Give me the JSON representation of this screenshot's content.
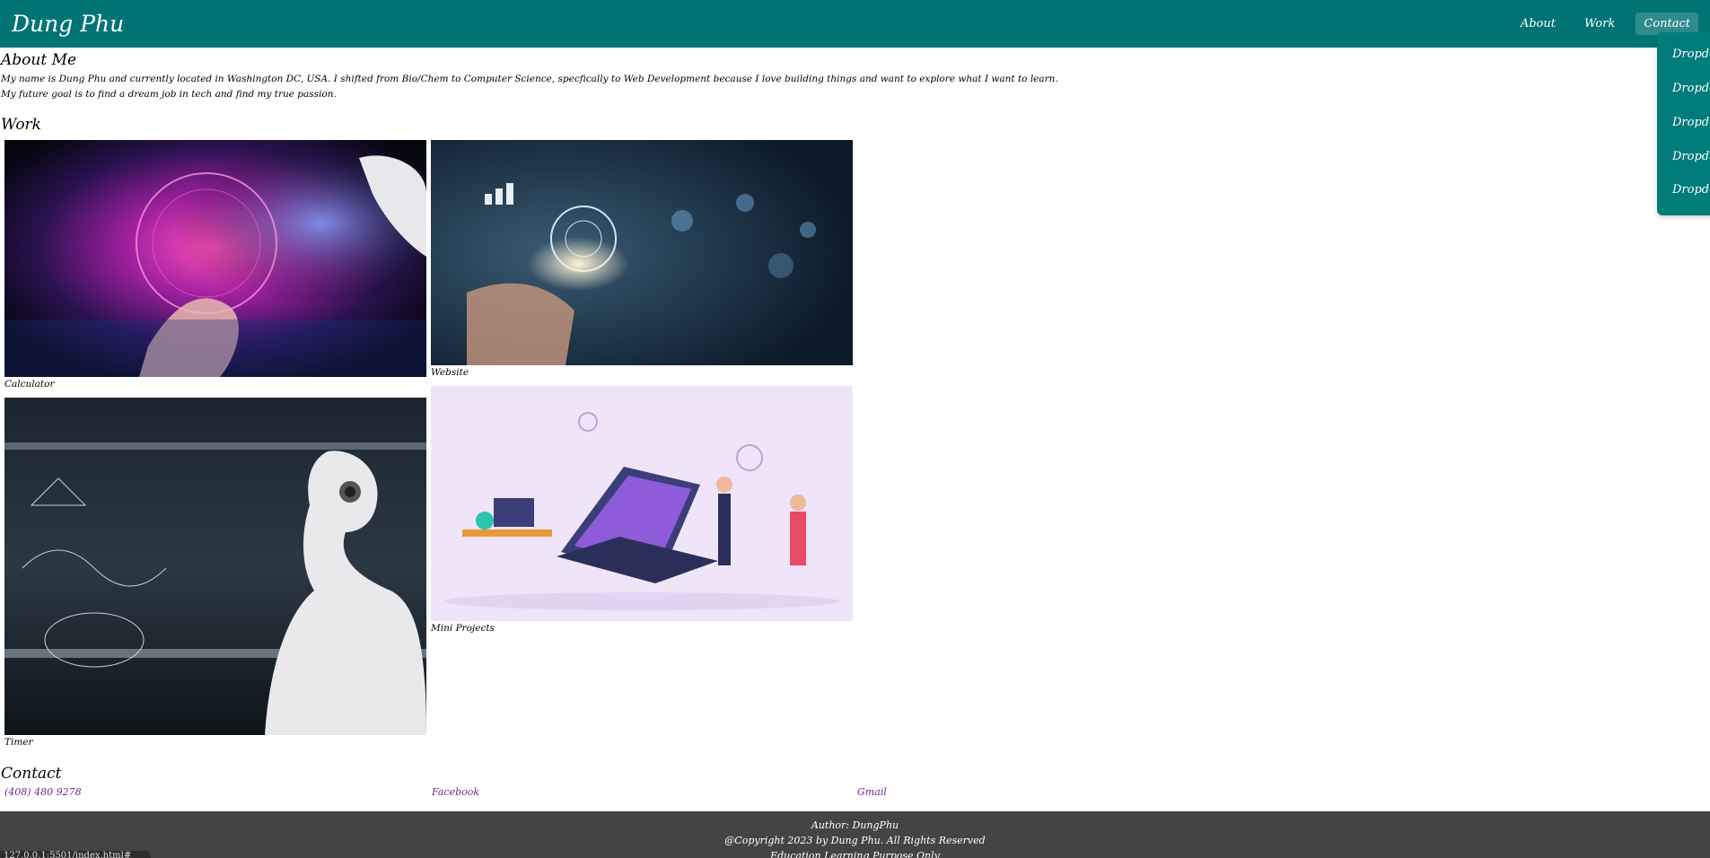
{
  "navbar": {
    "brand": "Dung Phu",
    "links": [
      "About",
      "Work",
      "Contact"
    ],
    "active": "Contact"
  },
  "dropdown": {
    "items": [
      "Dropdown",
      "Dropdown",
      "Dropdown",
      "Dropdown",
      "Dropdown"
    ]
  },
  "about": {
    "heading": "About Me",
    "line1": "My name is Dung Phu and currently located in Washington DC, USA. I shifted from Bio/Chem to Computer Science, specfically to Web Development because I love building things and want to explore what I want to learn.",
    "line2": "My future goal is to find a dream job in tech and find my true passion."
  },
  "work": {
    "heading": "Work",
    "projects": [
      {
        "caption": "Calculator",
        "image": "ai-hand-globe-image"
      },
      {
        "caption": "Website",
        "image": "globe-network-hand-image"
      },
      {
        "caption": "Timer",
        "image": "robot-math-board-image"
      },
      {
        "caption": "Mini Projects",
        "image": "laptop-people-illustration"
      }
    ]
  },
  "contact": {
    "heading": "Contact",
    "phone": "(408) 480 9278",
    "facebook": "Facebook",
    "gmail": "Gmail"
  },
  "footer": {
    "author": "Author: DungPhu",
    "copyright": "@Copyright 2023 by Dung Phu. All Rights Reserved",
    "note": "Education Learning Purpose Only"
  },
  "statusbar": {
    "text": "127.0.0.1:5501/index.html#"
  },
  "colors": {
    "navbar": "#007475",
    "footer": "#444444",
    "link": "#6b2a8c"
  }
}
